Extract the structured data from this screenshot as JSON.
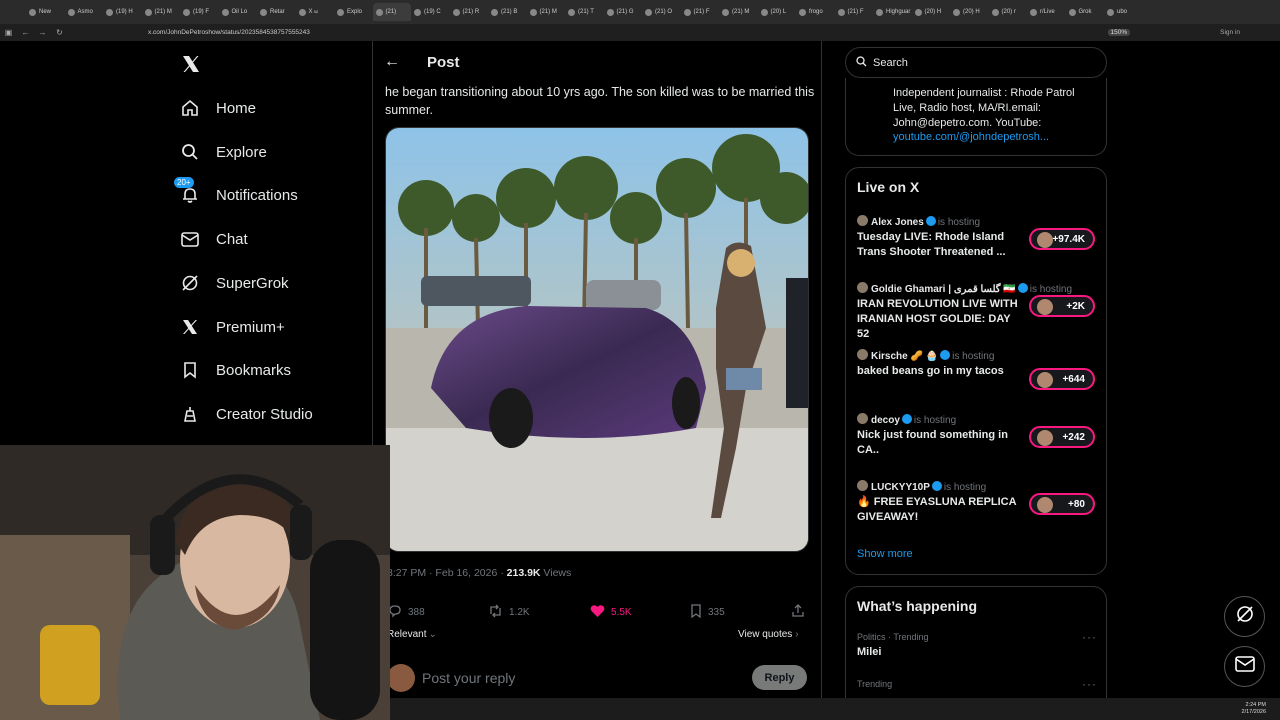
{
  "browser": {
    "tabs": [
      "New",
      "Asmo",
      "(19) H",
      "(21) M",
      "(19) F",
      "Oil Lo",
      "Retar",
      "X ಟ",
      "Explo",
      "(21)",
      "(19) C",
      "(21) R",
      "(21) B",
      "(21) M",
      "(21) T",
      "(21) G",
      "(21) O",
      "(21) F",
      "(21) M",
      "(20) L",
      "frogo",
      "(21) F",
      "Highguar",
      "(20) H",
      "(20) H",
      "(20) r",
      "r/Live",
      "Grok",
      "ubo"
    ],
    "active_tab_index": 9,
    "url": "x.com/JohnDePetroshow/status/2023584538757555243",
    "zoom": "150%",
    "signin_label": "Sign in"
  },
  "sidebar": {
    "items": [
      {
        "label": "Home",
        "icon": "home-icon"
      },
      {
        "label": "Explore",
        "icon": "search-icon"
      },
      {
        "label": "Notifications",
        "icon": "bell-icon"
      },
      {
        "label": "Chat",
        "icon": "mail-icon"
      },
      {
        "label": "SuperGrok",
        "icon": "grok-icon"
      },
      {
        "label": "Premium+",
        "icon": "x-logo-icon"
      },
      {
        "label": "Bookmarks",
        "icon": "bookmark-icon"
      },
      {
        "label": "Creator Studio",
        "icon": "creator-icon"
      }
    ],
    "notifications_badge": "20+"
  },
  "post": {
    "header_title": "Post",
    "text": "he began transitioning about 10 yrs ago. The son killed was to be married this summer.",
    "timestamp": "3:27 PM · Feb 16, 2026 · ",
    "views_count": "213.9K",
    "views_label": " Views",
    "replies": "388",
    "reposts": "1.2K",
    "likes": "5.5K",
    "bookmarks": "335",
    "sort_label": "Relevant",
    "view_quotes": "View quotes",
    "reply_placeholder": "Post your reply",
    "reply_button": "Reply"
  },
  "right": {
    "search_placeholder": "Search",
    "bio_lines": [
      "Independent journalist : Rhode Patrol",
      "Live, Radio host, MA/RI.email:",
      "John@depetro.com. YouTube:"
    ],
    "bio_link": "youtube.com/@johndepetrosh...",
    "live_title": "Live on X",
    "live": [
      {
        "name": "Alex Jones",
        "host": "is hosting",
        "title": "Tuesday LIVE: Rhode Island Trans Shooter Threatened ...",
        "count": "+97.4K"
      },
      {
        "name": "Goldie Ghamari | گلسا قمری 🇮🇷",
        "host": "is hosting",
        "title": "IRAN REVOLUTION LIVE WITH IRANIAN HOST GOLDIE: DAY 52",
        "count": "+2K"
      },
      {
        "name": "Kirsche 🥜 🧁",
        "host": "is hosting",
        "title": "baked beans go in my tacos",
        "count": "+644"
      },
      {
        "name": "decoy",
        "host": "is hosting",
        "title": "Nick just found something in CA..",
        "count": "+242"
      },
      {
        "name": "LUCKYY10P",
        "host": "is hosting",
        "title": "🔥 FREE EYASLUNA REPLICA GIVEAWAY!",
        "count": "+80"
      }
    ],
    "show_more": "Show more",
    "whats_happening": "What’s happening",
    "trends": [
      {
        "context": "Politics · Trending",
        "name": "Milei"
      },
      {
        "context": "Trending",
        "name": ""
      }
    ]
  },
  "taskbar": {
    "time": "2:24 PM",
    "date": "2/17/2026"
  },
  "colors": {
    "accent": "#1d9bf0",
    "like": "#f91880",
    "live_border": "#f91880",
    "text_secondary": "#71767b"
  }
}
